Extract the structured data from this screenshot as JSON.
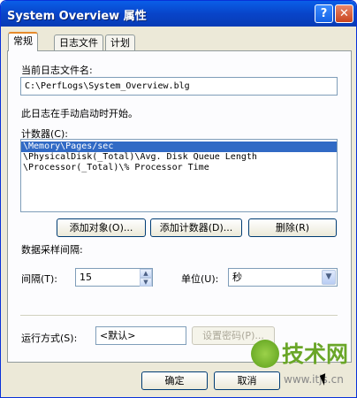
{
  "window": {
    "title": "System Overview 属性",
    "help_button": "?",
    "close_button": "✕"
  },
  "tabs": [
    "常规",
    "日志文件",
    "计划"
  ],
  "log_file": {
    "label": "当前日志文件名:",
    "value": "C:\\PerfLogs\\System_Overview.blg"
  },
  "log_status": "此日志在手动启动时开始。",
  "counters": {
    "label": "计数器(C):",
    "items": [
      "\\Memory\\Pages/sec",
      "\\PhysicalDisk(_Total)\\Avg. Disk Queue Length",
      "\\Processor(_Total)\\% Processor Time"
    ],
    "selected_index": 0
  },
  "buttons": {
    "add_objects": "添加对象(O)...",
    "add_counters": "添加计数器(D)...",
    "remove": "删除(R)",
    "set_password": "设置密码(P)...",
    "ok": "确定",
    "cancel": "取消"
  },
  "sampling": {
    "section_label": "数据采样间隔:",
    "interval_label": "间隔(T):",
    "interval_value": "15",
    "unit_label": "单位(U):",
    "unit_value": "秒"
  },
  "run_as": {
    "label": "运行方式(S):",
    "value": "<默认>"
  },
  "watermark": {
    "logo_text": "技术网",
    "url": "www.itjs.cn"
  }
}
